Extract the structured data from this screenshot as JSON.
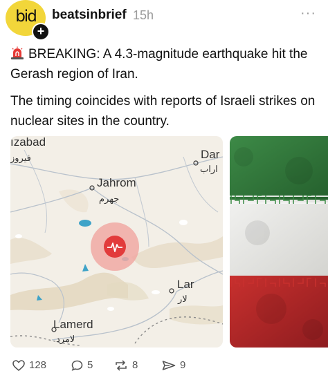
{
  "post": {
    "avatar_text": "bid",
    "username": "beatsinbrief",
    "time": "15h",
    "more_label": "···",
    "paragraph1": "BREAKING: A 4.3-magnitude earthquake hit the Gerash region of Iran.",
    "paragraph2": "The timing coincides with reports of Israeli strikes on nuclear sites in the country."
  },
  "map": {
    "labels": {
      "firuzabad_en": "ızabad",
      "firuzabad_fa": "فیروز",
      "darab_en": "Dar",
      "darab_fa": "اراب",
      "jahrom_en": "Jahrom",
      "jahrom_fa": "جهرم",
      "lar_en": "Lar",
      "lar_fa": "لار",
      "lamerd_en": "Lamerd",
      "lamerd_fa": "لامرد"
    }
  },
  "actions": {
    "likes": "128",
    "comments": "5",
    "restacks": "8",
    "shares": "9"
  },
  "colors": {
    "avatar_bg": "#f2d63a",
    "quake_marker": "#e23b3b",
    "flag_green": "#2f7a3a",
    "flag_red": "#b8262a"
  },
  "icons": [
    "siren-icon",
    "heart-icon",
    "comment-icon",
    "restack-icon",
    "share-icon",
    "plus-icon",
    "more-icon"
  ]
}
